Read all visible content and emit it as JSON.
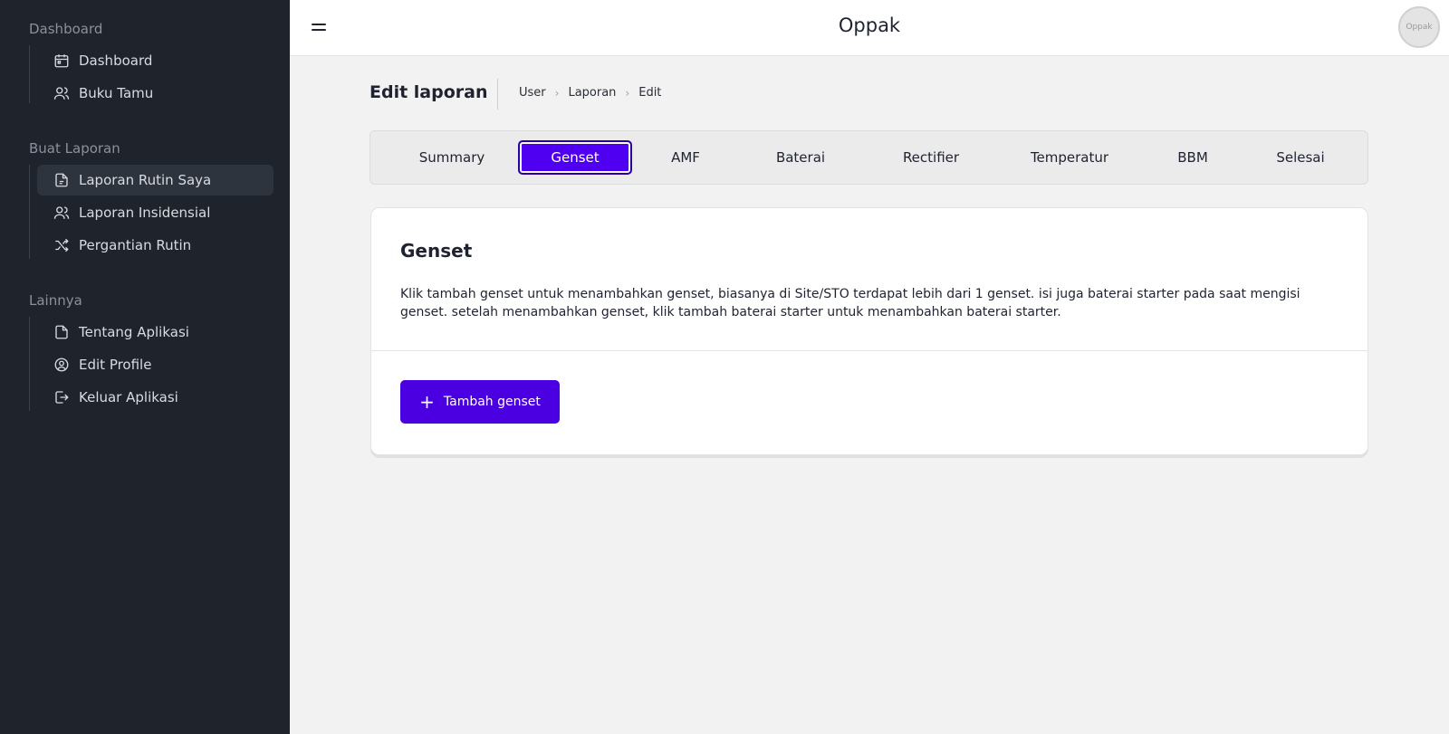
{
  "sidebar": {
    "sections": [
      {
        "title": "Dashboard",
        "items": [
          {
            "label": "Dashboard",
            "icon": "calendar-icon"
          },
          {
            "label": "Buku Tamu",
            "icon": "users-icon"
          }
        ]
      },
      {
        "title": "Buat Laporan",
        "items": [
          {
            "label": "Laporan Rutin Saya",
            "icon": "file-report-icon",
            "active": true
          },
          {
            "label": "Laporan Insidensial",
            "icon": "users-icon"
          },
          {
            "label": "Pergantian Rutin",
            "icon": "shuffle-icon"
          }
        ]
      },
      {
        "title": "Lainnya",
        "items": [
          {
            "label": "Tentang Aplikasi",
            "icon": "file-icon"
          },
          {
            "label": "Edit Profile",
            "icon": "user-circle-icon"
          },
          {
            "label": "Keluar Aplikasi",
            "icon": "logout-icon"
          }
        ]
      }
    ]
  },
  "header": {
    "title": "Oppak",
    "avatar_text": "Oppak"
  },
  "page": {
    "title": "Edit laporan",
    "breadcrumb": [
      "User",
      "Laporan",
      "Edit"
    ]
  },
  "tabs": [
    {
      "label": "Summary"
    },
    {
      "label": "Genset",
      "active": true
    },
    {
      "label": "AMF"
    },
    {
      "label": "Baterai"
    },
    {
      "label": "Rectifier"
    },
    {
      "label": "Temperatur"
    },
    {
      "label": "BBM"
    },
    {
      "label": "Selesai"
    }
  ],
  "card": {
    "title": "Genset",
    "description": "Klik tambah genset untuk menambahkan genset, biasanya di Site/STO terdapat lebih dari 1 genset. isi juga baterai starter pada saat mengisi genset. setelah menambahkan genset, klik tambah baterai starter untuk menambahkan baterai starter.",
    "add_button_label": "Tambah genset"
  },
  "colors": {
    "accent": "#4a00e0",
    "sidebar_bg": "#1f242c",
    "page_bg": "#f2f2f2"
  }
}
